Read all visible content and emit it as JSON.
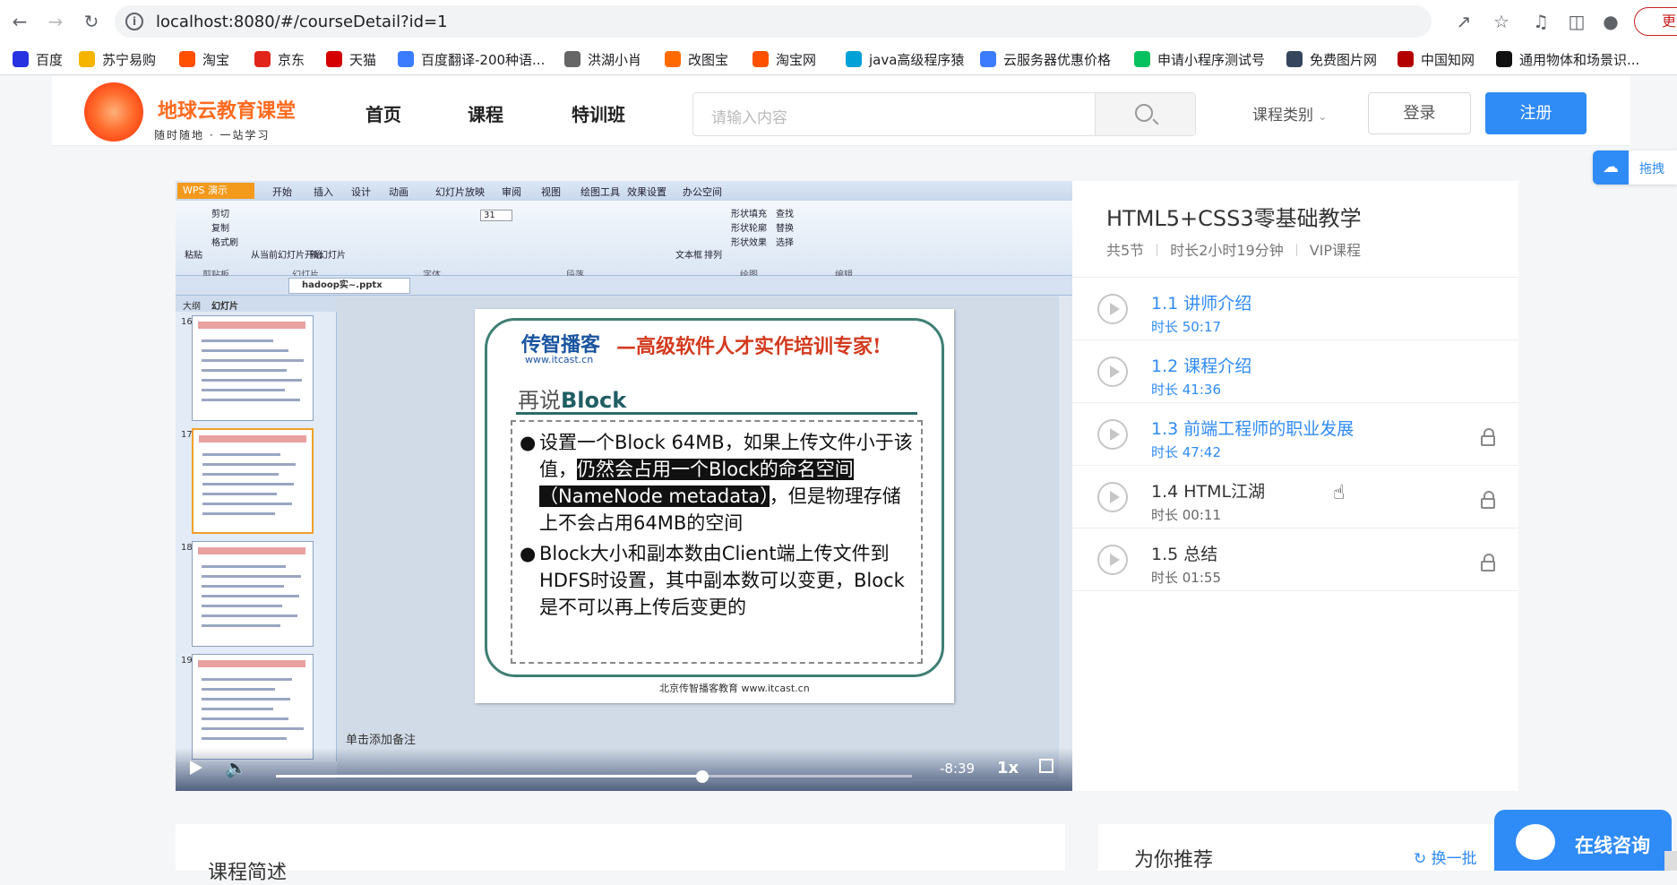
{
  "browser": {
    "url": "localhost:8080/#/courseDetail?id=1",
    "update_label": "更新"
  },
  "bookmarks": [
    {
      "label": "百度",
      "icon": "baidu-icon",
      "color": "#2932e1"
    },
    {
      "label": "苏宁易购",
      "icon": "suning-icon",
      "color": "#f5b400"
    },
    {
      "label": "淘宝",
      "icon": "taobao-icon",
      "color": "#ff5000"
    },
    {
      "label": "京东",
      "icon": "jd-icon",
      "color": "#e1251b"
    },
    {
      "label": "天猫",
      "icon": "tmall-icon",
      "color": "#d50000"
    },
    {
      "label": "百度翻译-200种语...",
      "icon": "translate-icon",
      "color": "#3b7cff"
    },
    {
      "label": "洪湖小肖",
      "icon": "person-icon",
      "color": "#666666"
    },
    {
      "label": "改图宝",
      "icon": "image-icon",
      "color": "#ff6a00"
    },
    {
      "label": "淘宝网",
      "icon": "taobao-icon",
      "color": "#ff5000"
    },
    {
      "label": "java高级程序猿",
      "icon": "bilibili-icon",
      "color": "#00a1d6"
    },
    {
      "label": "云服务器优惠价格",
      "icon": "cloud-icon",
      "color": "#3b7cff"
    },
    {
      "label": "申请小程序测试号",
      "icon": "wechat-icon",
      "color": "#07c160"
    },
    {
      "label": "免费图片网",
      "icon": "tumblr-icon",
      "color": "#35465c"
    },
    {
      "label": "中国知网",
      "icon": "cnki-icon",
      "color": "#b30000"
    },
    {
      "label": "通用物体和场景识...",
      "icon": "ai-icon",
      "color": "#111111"
    }
  ],
  "site": {
    "logo_text": "地球云教育课堂",
    "logo_sub": "随时随地 · 一站学习",
    "nav": [
      "首页",
      "课程",
      "特训班"
    ],
    "search_placeholder": "请输入内容",
    "category_label": "课程类别",
    "login_label": "登录",
    "register_label": "注册",
    "float_share_label": "拖拽"
  },
  "player": {
    "wps": {
      "app_label": "WPS 演示",
      "tabs": [
        "开始",
        "插入",
        "设计",
        "动画",
        "幻灯片放映",
        "审阅",
        "视图",
        "绘图工具",
        "效果设置",
        "办公空间"
      ],
      "doc_tab": "hadoop实~.pptx",
      "left_tabs": [
        "大纲",
        "幻灯片"
      ],
      "group_labels": [
        "剪贴板",
        "幻灯片",
        "字体",
        "段落",
        "绘图",
        "编辑"
      ],
      "ribbon_items": [
        "剪切",
        "复制",
        "格式刷",
        "粘贴",
        "从当前幻灯片开始",
        "新幻灯片",
        "文本框",
        "排列",
        "形状填充",
        "形状轮廓",
        "形状效果",
        "查找",
        "替换",
        "选择"
      ],
      "font_size": "31",
      "thumb_numbers": [
        "16",
        "17",
        "18",
        "19"
      ],
      "note": "单击添加备注"
    },
    "slide": {
      "brand": "传智播客",
      "brand_url": "www.itcast.cn",
      "motto": "—高级软件人才实作培训专家!",
      "heading_prefix": "再说",
      "heading_bold": "Block",
      "bullet1_a": "设置一个Block 64MB，如果上传文件小于该值，",
      "bullet1_sel": "仍然会占用一个Block的命名空间（NameNode metadata）",
      "bullet1_b": "，但是物理存储上不会占用64MB的空间",
      "bullet2": "Block大小和副本数由Client端上传文件到HDFS时设置，其中副本数可以变更，Block是不可以再上传后变更的",
      "footer": "北京传智播客教育 www.itcast.cn"
    },
    "time_left": "-8:39",
    "speed": "1x",
    "progress": 0.67
  },
  "course": {
    "title": "HTML5+CSS3零基础教学",
    "sections": "共5节",
    "duration": "时长2小时19分钟",
    "level": "VIP课程",
    "chapters": [
      {
        "title": "1.1 讲师介绍",
        "duration": "时长 50:17",
        "locked": false,
        "active": true
      },
      {
        "title": "1.2 课程介绍",
        "duration": "时长 41:36",
        "locked": false,
        "active": true
      },
      {
        "title": "1.3 前端工程师的职业发展",
        "duration": "时长 47:42",
        "locked": true,
        "active": true
      },
      {
        "title": "1.4 HTML江湖",
        "duration": "时长 00:11",
        "locked": true,
        "active": false
      },
      {
        "title": "1.5 总结",
        "duration": "时长 01:55",
        "locked": true,
        "active": false
      }
    ]
  },
  "bottom": {
    "brief_title": "课程简述",
    "recommend_title": "为你推荐",
    "refresh_label": "换一批",
    "consult_label": "在线咨询"
  }
}
